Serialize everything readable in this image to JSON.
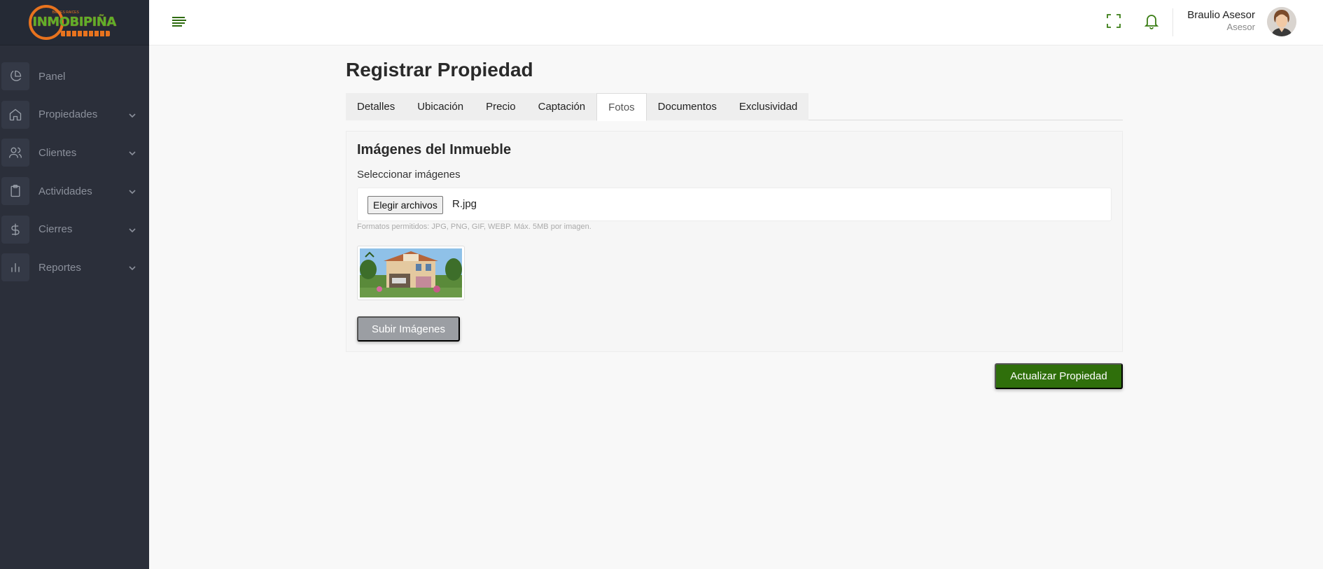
{
  "brand": {
    "logo_text": "INMOBIPIÑA",
    "logo_tagline": "BIENES RAICES",
    "accent_green": "#2f6f0b",
    "accent_orange": "#e8731e"
  },
  "sidebar": {
    "items": [
      {
        "label": "Panel",
        "icon": "pie-chart-icon",
        "has_chevron": false
      },
      {
        "label": "Propiedades",
        "icon": "home-icon",
        "has_chevron": true
      },
      {
        "label": "Clientes",
        "icon": "users-icon",
        "has_chevron": true
      },
      {
        "label": "Actividades",
        "icon": "clipboard-icon",
        "has_chevron": true
      },
      {
        "label": "Cierres",
        "icon": "dollar-icon",
        "has_chevron": true
      },
      {
        "label": "Reportes",
        "icon": "bar-chart-icon",
        "has_chevron": true
      }
    ]
  },
  "header": {
    "user_name": "Braulio Asesor",
    "user_role": "Asesor"
  },
  "page": {
    "title": "Registrar Propiedad",
    "tabs": [
      {
        "label": "Detalles",
        "active": false
      },
      {
        "label": "Ubicación",
        "active": false
      },
      {
        "label": "Precio",
        "active": false
      },
      {
        "label": "Captación",
        "active": false
      },
      {
        "label": "Fotos",
        "active": true
      },
      {
        "label": "Documentos",
        "active": false
      },
      {
        "label": "Exclusividad",
        "active": false
      }
    ]
  },
  "photos": {
    "section_title": "Imágenes del Inmueble",
    "select_label": "Seleccionar imágenes",
    "file_button": "Elegir archivos",
    "file_name": "R.jpg",
    "help_text": "Formatos permitidos: JPG, PNG, GIF, WEBP. Máx. 5MB por imagen.",
    "upload_button": "Subir Imágenes"
  },
  "actions": {
    "update_button": "Actualizar Propiedad"
  }
}
